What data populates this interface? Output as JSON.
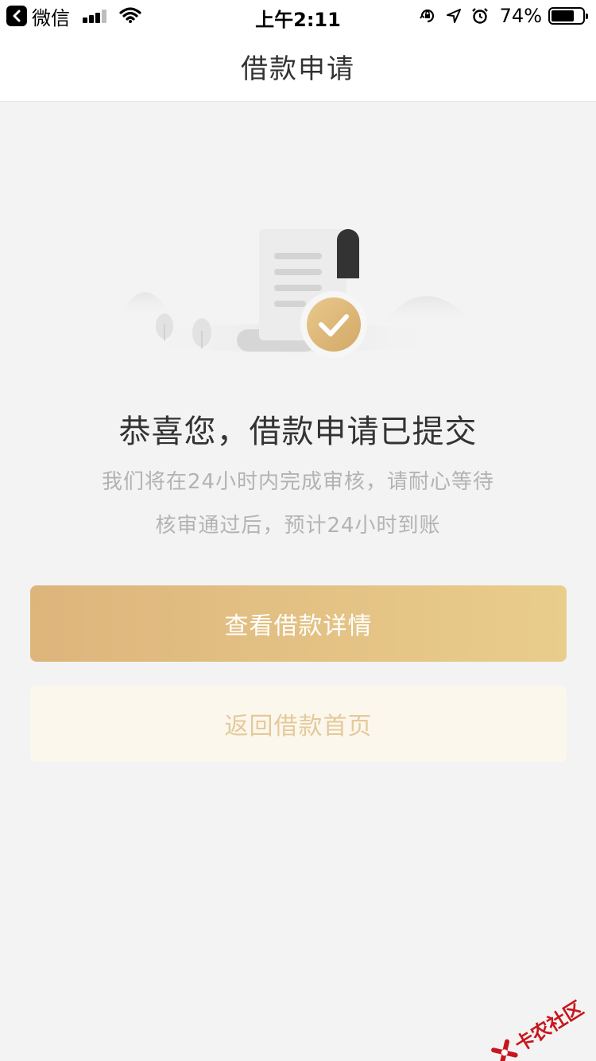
{
  "status_bar": {
    "back_app": "微信",
    "time": "上午2:11",
    "battery": "74%",
    "battery_level": 0.74,
    "icons": [
      "back-arrow-icon",
      "signal-icon",
      "wifi-icon",
      "rotation-lock-icon",
      "location-icon",
      "alarm-icon",
      "battery-icon"
    ]
  },
  "nav": {
    "title": "借款申请"
  },
  "result": {
    "illustration": "document-check-icon",
    "headline": "恭喜您，借款申请已提交",
    "line1": "我们将在24小时内完成审核，请耐心等待",
    "line2": "核审通过后，预计24小时到账"
  },
  "buttons": {
    "primary": "查看借款详情",
    "secondary": "返回借款首页"
  },
  "colors": {
    "gold_start": "#ddb57c",
    "gold_end": "#e9cd8c",
    "secondary_bg": "#fbf7ec",
    "secondary_text": "#e5c99a",
    "page_bg": "#f3f3f3"
  },
  "watermark": {
    "text": "卡农社区"
  }
}
